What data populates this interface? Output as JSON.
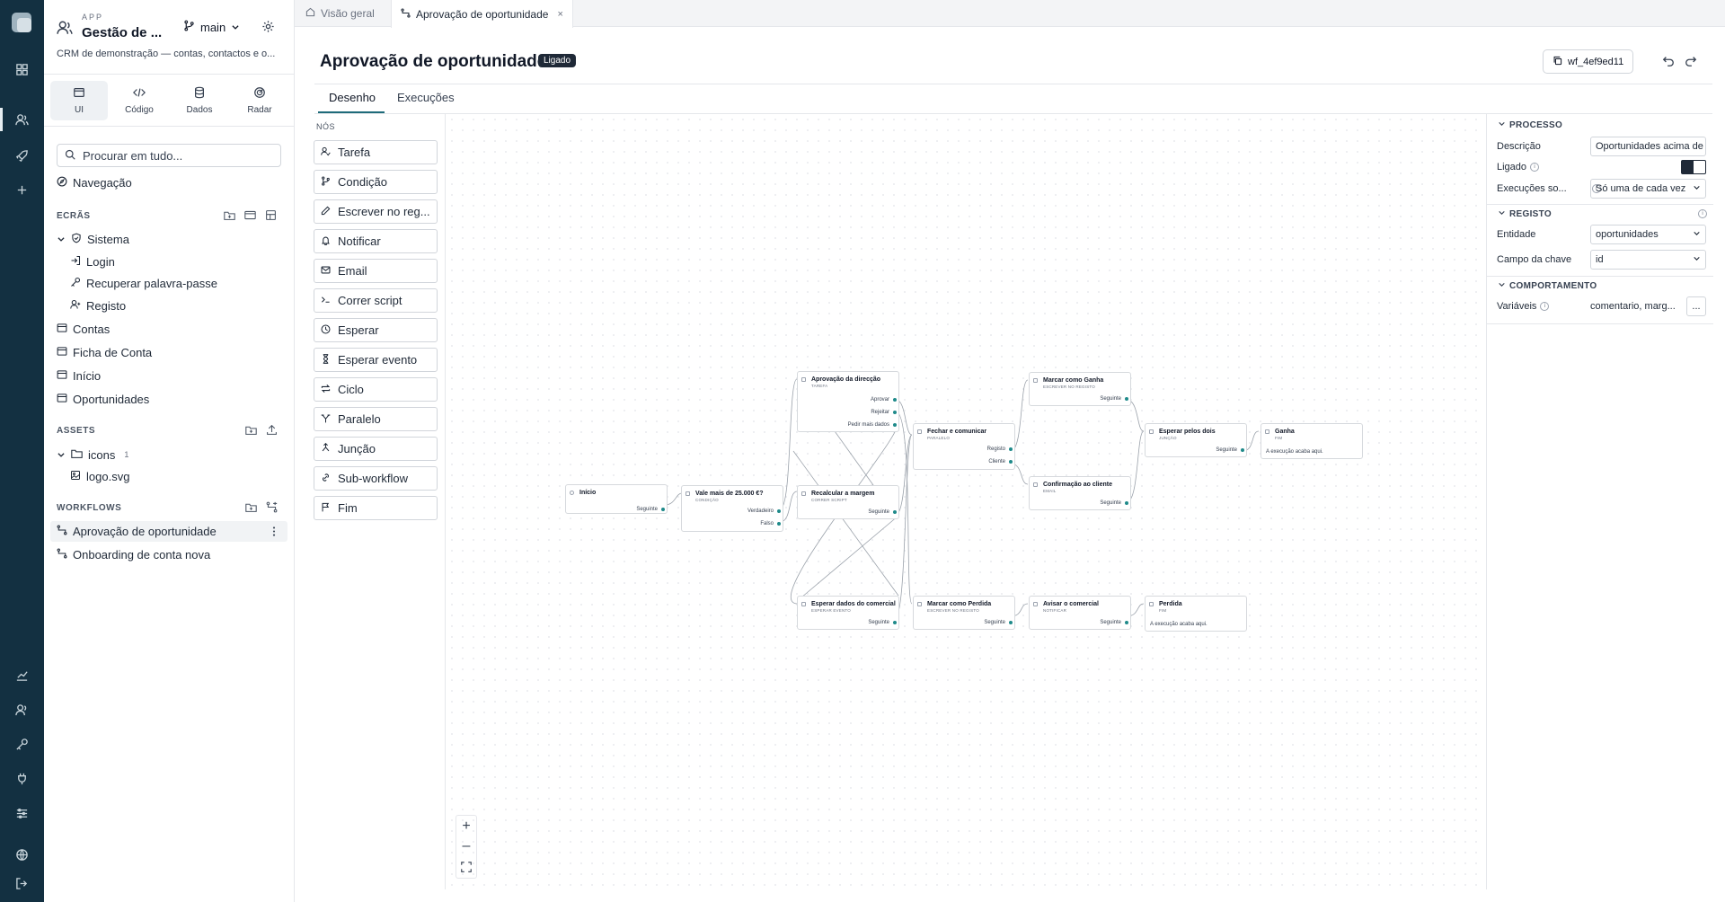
{
  "app": {
    "kicker": "APP",
    "title": "Gestão de ...",
    "branch": "main",
    "description": "CRM de demonstração — contas, contactos e o..."
  },
  "modes": [
    {
      "label": "UI",
      "icon": "layout-icon"
    },
    {
      "label": "Código",
      "icon": "code-icon"
    },
    {
      "label": "Dados",
      "icon": "database-icon"
    },
    {
      "label": "Radar",
      "icon": "radar-icon"
    }
  ],
  "search": {
    "placeholder": "Procurar em tudo..."
  },
  "nav": {
    "navegacao": "Navegação"
  },
  "sections": {
    "ecras": "ECRÃS",
    "assets": "ASSETS",
    "workflows": "WORKFLOWS"
  },
  "screens": {
    "sistema": "Sistema",
    "login": "Login",
    "recuperar": "Recuperar palavra-passe",
    "registo": "Registo",
    "contas": "Contas",
    "ficha": "Ficha de Conta",
    "inicio": "Início",
    "oportunidades": "Oportunidades"
  },
  "assets": {
    "folder": "icons",
    "folder_count": "1",
    "file": "logo.svg"
  },
  "workflows": [
    "Aprovação de oportunidade",
    "Onboarding de conta nova"
  ],
  "tabs": {
    "overview": "Visão geral",
    "current": "Aprovação de oportunidade",
    "close": "×"
  },
  "header": {
    "title": "Aprovação de oportunidade",
    "badge": "Ligado",
    "wf_id": "wf_4ef9ed11"
  },
  "content_tabs": {
    "design": "Desenho",
    "runs": "Execuções"
  },
  "palette": {
    "heading": "NÓS",
    "items": [
      "Tarefa",
      "Condição",
      "Escrever no reg...",
      "Notificar",
      "Email",
      "Correr script",
      "Esperar",
      "Esperar evento",
      "Ciclo",
      "Paralelo",
      "Junção",
      "Sub-workflow",
      "Fim"
    ]
  },
  "nodes": {
    "inicio": {
      "title": "Início",
      "out1": "Seguinte"
    },
    "vale": {
      "title": "Vale mais de 25.000 €?",
      "sub": "CONDIÇÃO",
      "out1": "Verdadeiro",
      "out2": "Falso"
    },
    "aprovacao": {
      "title": "Aprovação da direcção",
      "sub": "TAREFA",
      "out1": "Aprovar",
      "out2": "Rejeitar",
      "out3": "Pedir mais dados"
    },
    "recalcular": {
      "title": "Recalcular a margem",
      "sub": "CORRER SCRIPT",
      "out1": "Seguinte"
    },
    "esperar_dados": {
      "title": "Esperar dados do comercial",
      "sub": "ESPERAR EVENTO",
      "out1": "Seguinte"
    },
    "fechar": {
      "title": "Fechar e comunicar",
      "sub": "PARALELO",
      "out1": "Registo",
      "out2": "Cliente"
    },
    "marcar_perdida": {
      "title": "Marcar como Perdida",
      "sub": "ESCREVER NO REGISTO",
      "out1": "Seguinte"
    },
    "marcar_ganha": {
      "title": "Marcar como Ganha",
      "sub": "ESCREVER NO REGISTO",
      "out1": "Seguinte"
    },
    "confirmacao": {
      "title": "Confirmação ao cliente",
      "sub": "EMAIL",
      "out1": "Seguinte"
    },
    "avisar": {
      "title": "Avisar o comercial",
      "sub": "NOTIFICAR",
      "out1": "Seguinte"
    },
    "esperar_dois": {
      "title": "Esperar pelos dois",
      "sub": "JUNÇÃO",
      "out1": "Seguinte"
    },
    "ganha": {
      "title": "Ganha",
      "sub": "FIM",
      "note": "A execução acaba aqui."
    },
    "perdida": {
      "title": "Perdida",
      "sub": "FIM",
      "note": "A execução acaba aqui."
    }
  },
  "zoom": {
    "in": "+",
    "out": "–"
  },
  "inspector": {
    "processo": "PROCESSO",
    "descricao_label": "Descrição",
    "descricao_value": "Oportunidades acima de",
    "ligado_label": "Ligado",
    "execucoes_label": "Execuções so...",
    "execucoes_value": "Só uma de cada vez",
    "registo": "REGISTO",
    "entidade_label": "Entidade",
    "entidade_value": "oportunidades",
    "campo_label": "Campo da chave",
    "campo_value": "id",
    "comportamento": "COMPORTAMENTO",
    "variaveis_label": "Variáveis",
    "variaveis_value": "comentario, marg...",
    "more": "..."
  }
}
